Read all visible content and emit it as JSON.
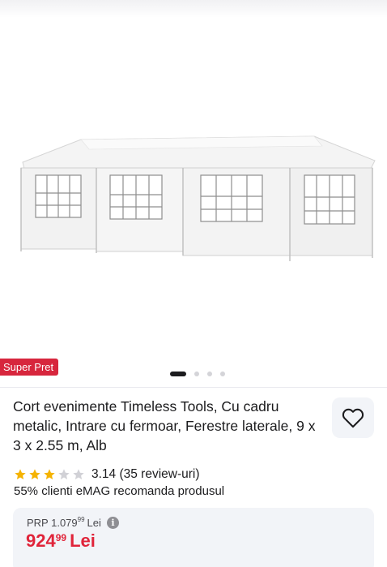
{
  "badge": {
    "label": "Super Pret"
  },
  "gallery": {
    "slide_count": 4,
    "active_index": 0
  },
  "product": {
    "title": "Cort evenimente Timeless Tools, Cu cadru metalic, Intrare cu fermoar, Ferestre laterale, 9 x 3 x 2.55 m, Alb"
  },
  "rating": {
    "stars_filled": 3,
    "stars_total": 5,
    "text": "3.14 (35 review-uri)"
  },
  "recommend": {
    "text": "55% clienti eMAG recomanda produsul"
  },
  "price": {
    "prp_label": "PRP 1.079",
    "prp_decimals": "99",
    "prp_currency": "Lei",
    "info_icon": "i",
    "main_int": "924",
    "main_decimals": "99",
    "main_currency": "Lei"
  },
  "colors": {
    "accent_red": "#e0243a",
    "badge_red": "#d7263d",
    "star_gold": "#f5b301",
    "star_gray": "#d1d1d6"
  },
  "icons": {
    "favorite": "heart-outline-icon",
    "info": "info-icon",
    "star": "star-icon"
  }
}
